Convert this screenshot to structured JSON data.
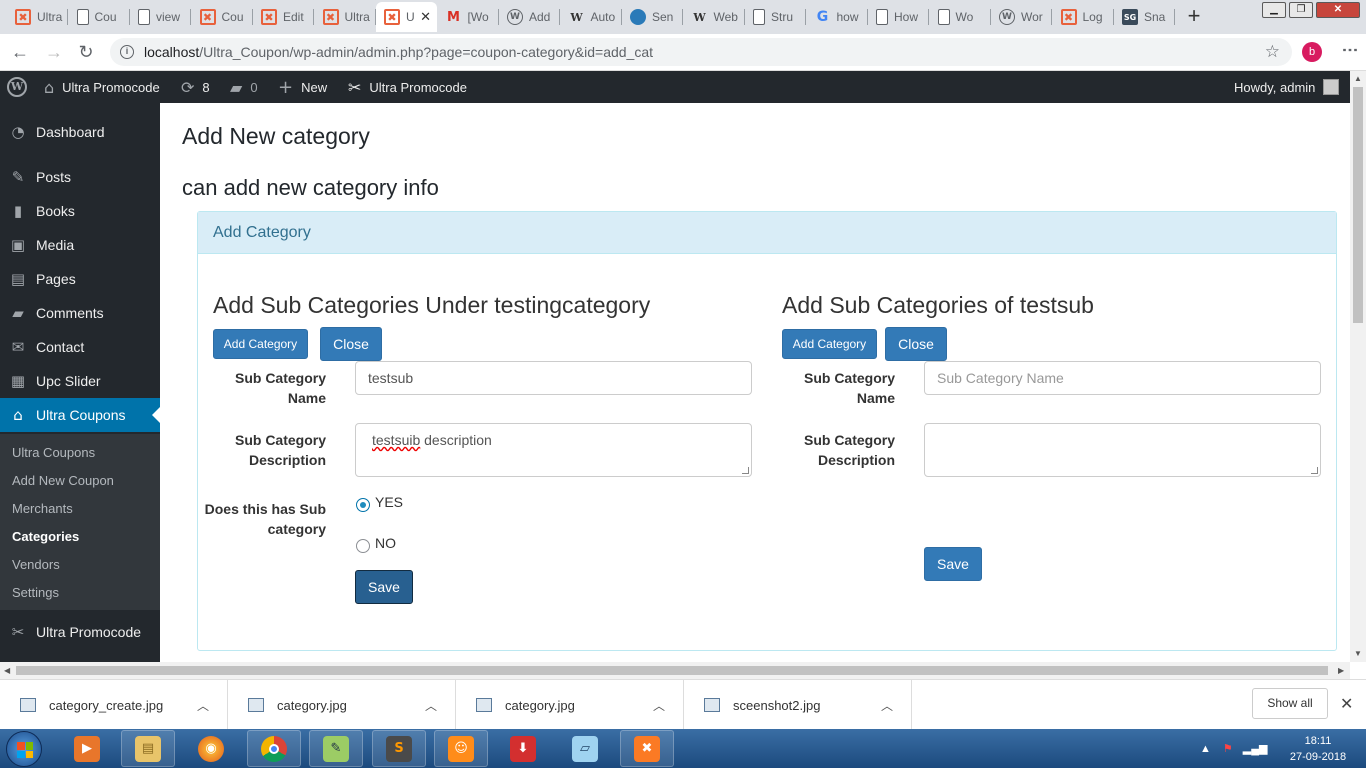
{
  "browser": {
    "tabs": [
      {
        "title": "Ultra",
        "icon": "xampp"
      },
      {
        "title": "Cou",
        "icon": "doc"
      },
      {
        "title": "view",
        "icon": "doc"
      },
      {
        "title": "Cou",
        "icon": "xampp"
      },
      {
        "title": "Edit",
        "icon": "xampp"
      },
      {
        "title": "Ultra",
        "icon": "xampp"
      },
      {
        "title": "U",
        "icon": "xampp",
        "active": true
      },
      {
        "title": "[Wo",
        "icon": "gmail"
      },
      {
        "title": "Add",
        "icon": "wordpress"
      },
      {
        "title": "Auto",
        "icon": "wiki"
      },
      {
        "title": "Sen",
        "icon": "sendgrid"
      },
      {
        "title": "Web",
        "icon": "wiki"
      },
      {
        "title": "Stru",
        "icon": "doc"
      },
      {
        "title": "how",
        "icon": "google"
      },
      {
        "title": "How",
        "icon": "doc"
      },
      {
        "title": "Wo",
        "icon": "doc"
      },
      {
        "title": "Wor",
        "icon": "wordpress"
      },
      {
        "title": "Log",
        "icon": "xampp"
      },
      {
        "title": "Sna",
        "icon": "sg"
      }
    ],
    "url_host": "localhost",
    "url_path": "/Ultra_Coupon/wp-admin/admin.php?page=coupon-category&id=add_cat",
    "profile_initial": "b"
  },
  "adminbar": {
    "site_name": "Ultra Promocode",
    "updates_count": "8",
    "comments_count": "0",
    "new_label": "New",
    "plugin_label": "Ultra Promocode",
    "howdy": "Howdy, admin"
  },
  "sidebar": {
    "items": [
      {
        "label": "Dashboard",
        "icon": "dashboard-icon"
      },
      {
        "label": "Posts",
        "icon": "pin-icon"
      },
      {
        "label": "Books",
        "icon": "book-icon"
      },
      {
        "label": "Media",
        "icon": "media-icon"
      },
      {
        "label": "Pages",
        "icon": "pages-icon"
      },
      {
        "label": "Comments",
        "icon": "comment-icon"
      },
      {
        "label": "Contact",
        "icon": "mail-icon"
      },
      {
        "label": "Upc Slider",
        "icon": "slider-icon"
      },
      {
        "label": "Ultra Coupons",
        "icon": "store-icon"
      }
    ],
    "submenu": [
      "Ultra Coupons",
      "Add New Coupon",
      "Merchants",
      "Categories",
      "Vendors",
      "Settings"
    ],
    "bottom_item": "Ultra Promocode"
  },
  "main": {
    "title": "Add New category",
    "subtitle": "can add new category info",
    "panel_heading": "Add Category",
    "left": {
      "title": "Add Sub Categories Under testingcategory",
      "add_button": "Add Category",
      "close_button": "Close",
      "name_label": "Sub Category Name",
      "name_value": "testsub",
      "desc_label": "Sub Category Description",
      "desc_value_word": "testsuib",
      "desc_value_rest": " description",
      "has_sub_label": "Does this has Sub category",
      "yes_label": "YES",
      "no_label": "NO",
      "selected": "YES",
      "save_button": "Save"
    },
    "right": {
      "title": "Add Sub Categories of testsub",
      "add_button": "Add Category",
      "close_button": "Close",
      "name_label": "Sub Category Name",
      "name_placeholder": "Sub Category Name",
      "desc_label": "Sub Category Description",
      "save_button": "Save"
    }
  },
  "downloads": {
    "files": [
      "category_create.jpg",
      "category.jpg",
      "category.jpg",
      "sceenshot2.jpg"
    ],
    "show_all": "Show all"
  },
  "taskbar": {
    "time": "18:11",
    "date": "27-09-2018"
  },
  "colors": {
    "wp_dark": "#23282d",
    "wp_blue": "#0073aa",
    "bootstrap_primary": "#337ab7",
    "panel_info": "#d9edf7"
  }
}
